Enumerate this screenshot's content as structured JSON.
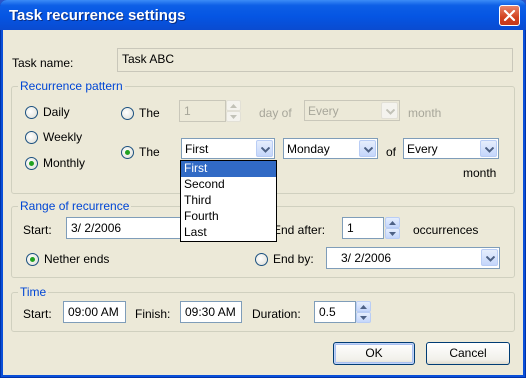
{
  "window": {
    "title": "Task recurrence settings",
    "close_icon": "close-icon"
  },
  "task": {
    "label": "Task name:",
    "value": "Task ABC"
  },
  "recurrence": {
    "group_title": "Recurrence pattern",
    "daily": "Daily",
    "weekly": "Weekly",
    "monthly": "Monthly",
    "row1": {
      "radio": "The",
      "number": "1",
      "day_of": "day of",
      "month_combo": "Every",
      "month": "month"
    },
    "row2": {
      "radio": "The",
      "ordinal_combo": "First",
      "day_combo": "Monday",
      "of": "of",
      "every_combo": "Every",
      "month": "month"
    },
    "ordinal_options": [
      "First",
      "Second",
      "Third",
      "Fourth",
      "Last"
    ]
  },
  "range": {
    "group_title": "Range of recurrence",
    "start_label": "Start:",
    "start_value": "3/  2/2006",
    "end_after_label": "End after:",
    "occurrences_value": "1",
    "occurrences_label": "occurrences",
    "never_ends": "Nether ends",
    "end_by_label": "End by:",
    "end_by_value": "3/  2/2006"
  },
  "time": {
    "group_title": "Time",
    "start_label": "Start:",
    "start_value": "09:00 AM",
    "finish_label": "Finish:",
    "finish_value": "09:30 AM",
    "duration_label": "Duration:",
    "duration_value": "0.5"
  },
  "buttons": {
    "ok": "OK",
    "cancel": "Cancel"
  },
  "state": {
    "selected_pattern": "Monthly",
    "selected_monthly_option": "second",
    "selected_range": "Nether ends",
    "ordinal_dropdown_open": true,
    "ordinal_highlighted": "First"
  },
  "colors": {
    "titlebar": "#0555e3",
    "dialog_bg": "#ece9d8",
    "group_title": "#0046d5",
    "selection": "#316ac5",
    "radio_dot": "#21a121",
    "close_button": "#d2421f"
  }
}
